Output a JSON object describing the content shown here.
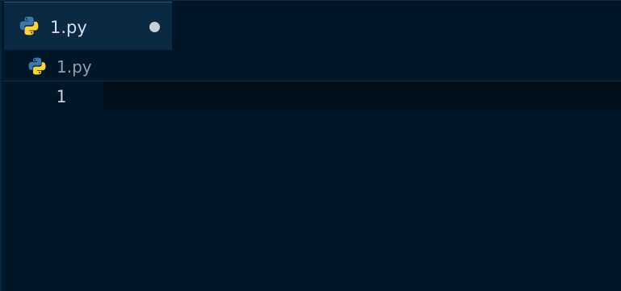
{
  "tabs": [
    {
      "label": "1.py",
      "icon": "python-icon",
      "dirty": true
    }
  ],
  "breadcrumb": {
    "label": "1.py",
    "icon": "python-icon"
  },
  "editor": {
    "line_numbers": [
      "1"
    ],
    "lines": [
      ""
    ]
  },
  "colors": {
    "background": "#011627",
    "tab_active": "#0b2942",
    "current_line": "#010e1a",
    "python_blue": "#3b77a8",
    "python_yellow": "#ffd43b"
  }
}
